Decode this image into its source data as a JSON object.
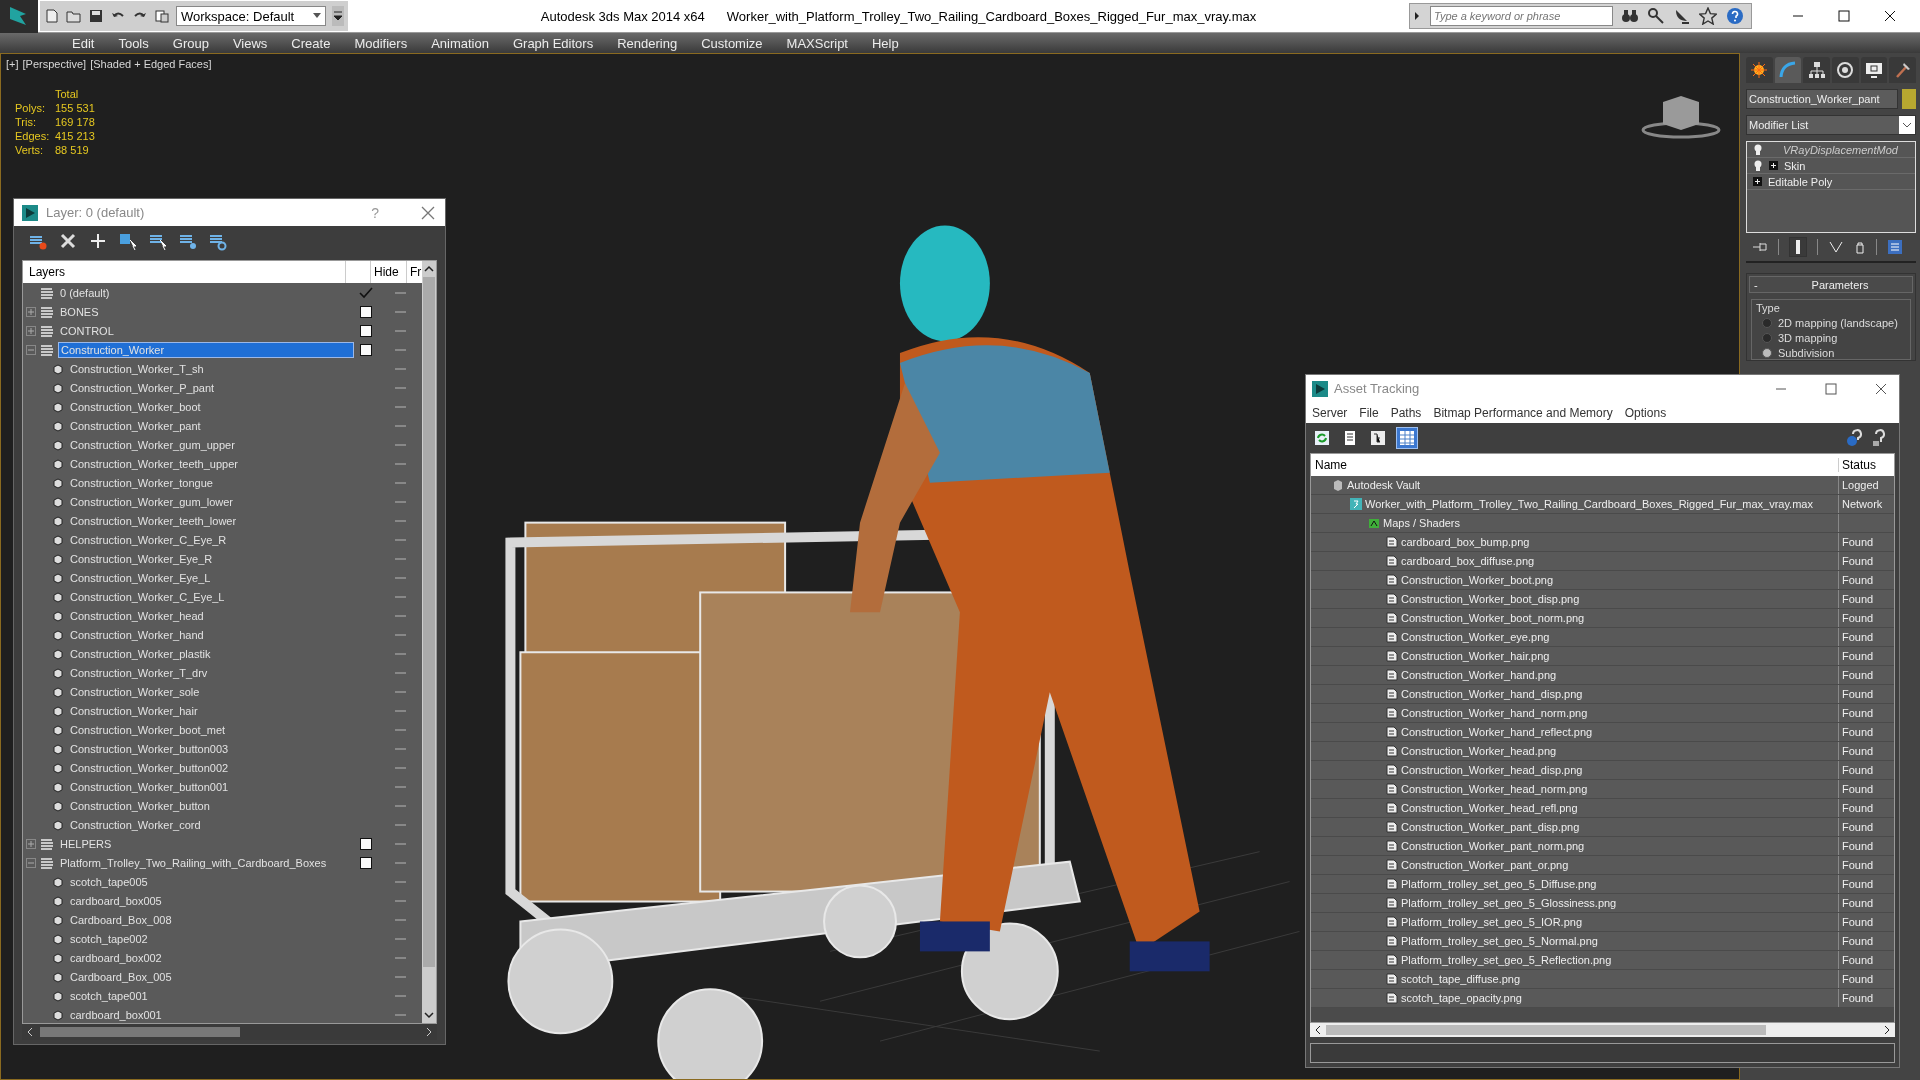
{
  "app_bar": {
    "workspace": "Workspace: Default",
    "title": "Autodesk 3ds Max  2014 x64",
    "file_name": "Worker_with_Platform_Trolley_Two_Railing_Cardboard_Boxes_Rigged_Fur_max_vray.max",
    "search": {
      "placeholder": "Type a keyword or phrase"
    }
  },
  "menu": [
    "Edit",
    "Tools",
    "Group",
    "Views",
    "Create",
    "Modifiers",
    "Animation",
    "Graph Editors",
    "Rendering",
    "Customize",
    "MAXScript",
    "Help"
  ],
  "viewport": {
    "labels": [
      "[+]",
      "[Perspective]",
      "[Shaded + Edged Faces]"
    ],
    "stats": {
      "header": "Total",
      "rows": [
        {
          "label": "Polys:",
          "value": "155 531"
        },
        {
          "label": "Tris:",
          "value": "169 178"
        },
        {
          "label": "Edges:",
          "value": "415 213"
        },
        {
          "label": "Verts:",
          "value": "88 519"
        }
      ]
    }
  },
  "layer_window": {
    "title": "Layer: 0 (default)",
    "help": "?",
    "columns": [
      "Layers",
      "Hide",
      "Fr"
    ],
    "layers": [
      {
        "name": "0 (default)",
        "current": true,
        "selected": false
      },
      {
        "name": "BONES",
        "current": false,
        "expanded": false,
        "selected": false
      },
      {
        "name": "CONTROL",
        "current": false,
        "expanded": false,
        "selected": false
      },
      {
        "name": "Construction_Worker",
        "current": false,
        "expanded": true,
        "selected": true,
        "children": [
          {
            "name": "Construction_Worker_T_sh",
            "selected": false
          },
          {
            "name": "Construction_Worker_P_pant",
            "selected": false
          },
          {
            "name": "Construction_Worker_boot",
            "selected": false
          },
          {
            "name": "Construction_Worker_pant",
            "selected": false
          },
          {
            "name": "Construction_Worker_gum_upper",
            "selected": false
          },
          {
            "name": "Construction_Worker_teeth_upper",
            "selected": false
          },
          {
            "name": "Construction_Worker_tongue",
            "selected": false
          },
          {
            "name": "Construction_Worker_gum_lower",
            "selected": false
          },
          {
            "name": "Construction_Worker_teeth_lower",
            "selected": false
          },
          {
            "name": "Construction_Worker_C_Eye_R",
            "selected": false
          },
          {
            "name": "Construction_Worker_Eye_R",
            "selected": false
          },
          {
            "name": "Construction_Worker_Eye_L",
            "selected": false
          },
          {
            "name": "Construction_Worker_C_Eye_L",
            "selected": false
          },
          {
            "name": "Construction_Worker_head",
            "selected": false
          },
          {
            "name": "Construction_Worker_hand",
            "selected": false
          },
          {
            "name": "Construction_Worker_plastik",
            "selected": false
          },
          {
            "name": "Construction_Worker_T_drv",
            "selected": false
          },
          {
            "name": "Construction_Worker_sole",
            "selected": false
          },
          {
            "name": "Construction_Worker_hair",
            "selected": false
          },
          {
            "name": "Construction_Worker_boot_met",
            "selected": false
          },
          {
            "name": "Construction_Worker_button003",
            "selected": false
          },
          {
            "name": "Construction_Worker_button002",
            "selected": false
          },
          {
            "name": "Construction_Worker_button001",
            "selected": false
          },
          {
            "name": "Construction_Worker_button",
            "selected": false
          },
          {
            "name": "Construction_Worker_cord",
            "selected": false
          }
        ]
      },
      {
        "name": "HELPERS",
        "current": false,
        "expanded": false,
        "selected": false
      },
      {
        "name": "Platform_Trolley_Two_Railing_with_Cardboard_Boxes",
        "current": false,
        "expanded": true,
        "selected": false,
        "children": [
          {
            "name": "scotch_tape005",
            "selected": false
          },
          {
            "name": "cardboard_box005",
            "selected": false
          },
          {
            "name": "Cardboard_Box_008",
            "selected": false
          },
          {
            "name": "scotch_tape002",
            "selected": false
          },
          {
            "name": "cardboard_box002",
            "selected": false
          },
          {
            "name": "Cardboard_Box_005",
            "selected": false
          },
          {
            "name": "scotch_tape001",
            "selected": false
          },
          {
            "name": "cardboard_box001",
            "selected": false
          }
        ]
      }
    ]
  },
  "command_panel": {
    "tabs": [
      {
        "kind": "create",
        "selected": false
      },
      {
        "kind": "modify",
        "selected": true
      },
      {
        "kind": "hierarchy",
        "selected": false
      },
      {
        "kind": "motion",
        "selected": false
      },
      {
        "kind": "display",
        "selected": false
      },
      {
        "kind": "utilities",
        "selected": false
      }
    ],
    "object_name": "Construction_Worker_pant",
    "modifier_list": "Modifier List",
    "stack": [
      {
        "label": "VRayDisplacementMod",
        "bulb": true,
        "expandable": false,
        "instanced": true
      },
      {
        "label": "Skin",
        "bulb": true,
        "expandable": true,
        "instanced": false
      },
      {
        "label": "Editable Poly",
        "bulb": false,
        "expandable": true,
        "instanced": false
      }
    ],
    "rollout": {
      "collapse": "-",
      "title": "Parameters",
      "group": "Type",
      "options": [
        {
          "label": "2D mapping (landscape)",
          "selected": false
        },
        {
          "label": "3D mapping",
          "selected": false
        },
        {
          "label": "Subdivision",
          "selected": true
        }
      ]
    }
  },
  "asset_window": {
    "title": "Asset Tracking",
    "menu": [
      "Server",
      "File",
      "Paths",
      "Bitmap Performance and Memory",
      "Options"
    ],
    "view_modes": [
      {
        "kind": "refresh",
        "selected": false
      },
      {
        "kind": "list",
        "selected": false
      },
      {
        "kind": "tree",
        "selected": false
      },
      {
        "kind": "table",
        "selected": true
      }
    ],
    "columns": [
      "Name",
      "Status"
    ],
    "assets": [
      {
        "kind": "vault",
        "name": "Autodesk Vault",
        "status": "Logged",
        "children": [
          {
            "kind": "maxfile",
            "name": "Worker_with_Platform_Trolley_Two_Railing_Cardboard_Boxes_Rigged_Fur_max_vray.max",
            "status": "Network",
            "children": [
              {
                "kind": "folder",
                "name": "Maps / Shaders",
                "children": [
                  {
                    "kind": "file",
                    "name": "cardboard_box_bump.png",
                    "status": "Found"
                  },
                  {
                    "kind": "file",
                    "name": "cardboard_box_diffuse.png",
                    "status": "Found"
                  },
                  {
                    "kind": "file",
                    "name": "Construction_Worker_boot.png",
                    "status": "Found"
                  },
                  {
                    "kind": "file",
                    "name": "Construction_Worker_boot_disp.png",
                    "status": "Found"
                  },
                  {
                    "kind": "file",
                    "name": "Construction_Worker_boot_norm.png",
                    "status": "Found"
                  },
                  {
                    "kind": "file",
                    "name": "Construction_Worker_eye.png",
                    "status": "Found"
                  },
                  {
                    "kind": "file",
                    "name": "Construction_Worker_hair.png",
                    "status": "Found"
                  },
                  {
                    "kind": "file",
                    "name": "Construction_Worker_hand.png",
                    "status": "Found"
                  },
                  {
                    "kind": "file",
                    "name": "Construction_Worker_hand_disp.png",
                    "status": "Found"
                  },
                  {
                    "kind": "file",
                    "name": "Construction_Worker_hand_norm.png",
                    "status": "Found"
                  },
                  {
                    "kind": "file",
                    "name": "Construction_Worker_hand_reflect.png",
                    "status": "Found"
                  },
                  {
                    "kind": "file",
                    "name": "Construction_Worker_head.png",
                    "status": "Found"
                  },
                  {
                    "kind": "file",
                    "name": "Construction_Worker_head_disp.png",
                    "status": "Found"
                  },
                  {
                    "kind": "file",
                    "name": "Construction_Worker_head_norm.png",
                    "status": "Found"
                  },
                  {
                    "kind": "file",
                    "name": "Construction_Worker_head_refl.png",
                    "status": "Found"
                  },
                  {
                    "kind": "file",
                    "name": "Construction_Worker_pant_disp.png",
                    "status": "Found"
                  },
                  {
                    "kind": "file",
                    "name": "Construction_Worker_pant_norm.png",
                    "status": "Found"
                  },
                  {
                    "kind": "file",
                    "name": "Construction_Worker_pant_or.png",
                    "status": "Found"
                  },
                  {
                    "kind": "file",
                    "name": "Platform_trolley_set_geo_5_Diffuse.png",
                    "status": "Found"
                  },
                  {
                    "kind": "file",
                    "name": "Platform_trolley_set_geo_5_Glossiness.png",
                    "status": "Found"
                  },
                  {
                    "kind": "file",
                    "name": "Platform_trolley_set_geo_5_IOR.png",
                    "status": "Found"
                  },
                  {
                    "kind": "file",
                    "name": "Platform_trolley_set_geo_5_Normal.png",
                    "status": "Found"
                  },
                  {
                    "kind": "file",
                    "name": "Platform_trolley_set_geo_5_Reflection.png",
                    "status": "Found"
                  },
                  {
                    "kind": "file",
                    "name": "scotch_tape_diffuse.png",
                    "status": "Found"
                  },
                  {
                    "kind": "file",
                    "name": "scotch_tape_opacity.png",
                    "status": "Found"
                  }
                ]
              }
            ]
          }
        ]
      }
    ]
  }
}
